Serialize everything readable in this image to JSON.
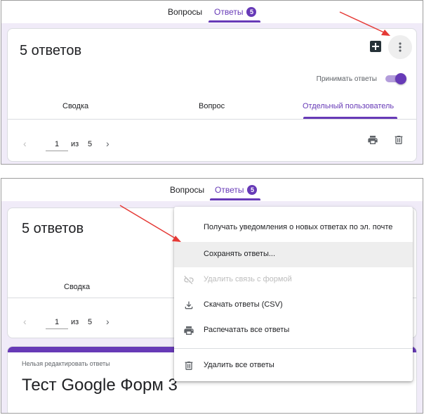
{
  "tabs": {
    "questions": "Вопросы",
    "responses": "Ответы",
    "count": "5"
  },
  "summary": {
    "title": "5 ответов",
    "accept_label": "Принимать ответы",
    "subtabs": {
      "summary": "Сводка",
      "question": "Вопрос",
      "individual": "Отдельный пользователь"
    }
  },
  "pager": {
    "prev": "‹",
    "current": "1",
    "of": "из",
    "total": "5",
    "next": "›"
  },
  "menu": {
    "items": [
      {
        "label": "Получать уведомления о новых ответах по эл. почте"
      },
      {
        "label": "Сохранять ответы..."
      },
      {
        "label": "Удалить связь с формой"
      },
      {
        "label": "Скачать ответы (CSV)"
      },
      {
        "label": "Распечатать все ответы"
      },
      {
        "label": "Удалить все ответы"
      }
    ]
  },
  "form": {
    "note": "Нельзя редактировать ответы",
    "title": "Тест Google Форм 3"
  },
  "colors": {
    "accent": "#673ab7",
    "background": "#f0ebf8",
    "arrow": "#e53935",
    "sheets_green": "#0f9d58"
  },
  "icons": [
    "add-to-sheets-icon",
    "more-vert-icon",
    "print-icon",
    "delete-icon",
    "link-off-icon",
    "download-icon"
  ]
}
